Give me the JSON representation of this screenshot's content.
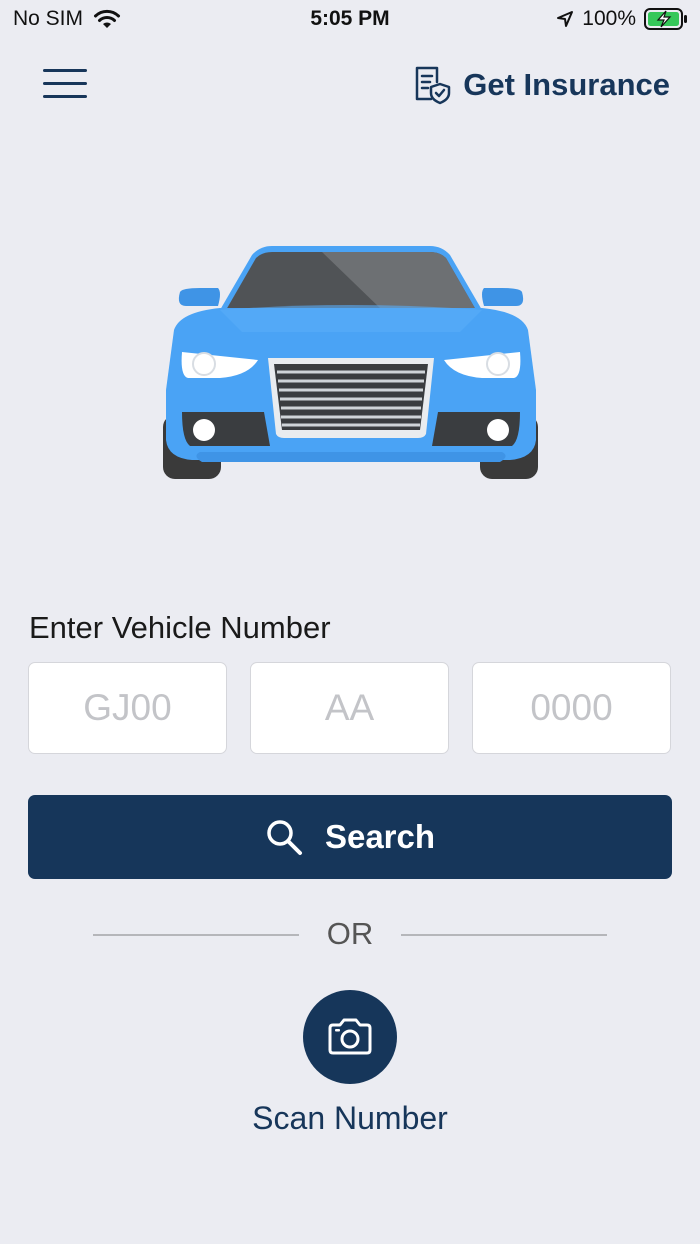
{
  "status_bar": {
    "carrier": "No SIM",
    "time": "5:05 PM",
    "battery": "100%"
  },
  "header": {
    "menu_icon": "hamburger-menu-icon",
    "get_insurance_label": "Get Insurance",
    "get_insurance_icon": "insurance-document-shield-icon"
  },
  "hero": {
    "image": "blue-car-front-illustration"
  },
  "vehicle_form": {
    "label": "Enter Vehicle Number",
    "state_code": {
      "value": "",
      "placeholder": "GJ00"
    },
    "series": {
      "value": "",
      "placeholder": "AA"
    },
    "number": {
      "value": "",
      "placeholder": "0000"
    }
  },
  "search_button": {
    "label": "Search",
    "icon": "search-icon"
  },
  "divider": {
    "text": "OR"
  },
  "scan": {
    "label": "Scan Number",
    "icon": "camera-icon"
  },
  "colors": {
    "primary": "#16365a",
    "background": "#ebecf2",
    "car_body": "#4aa3f5"
  }
}
